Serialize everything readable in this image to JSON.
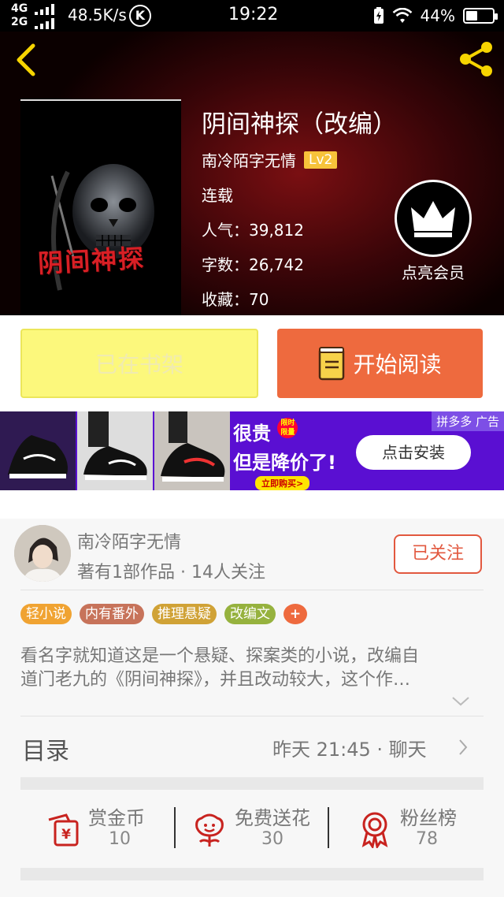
{
  "status_bar": {
    "network_top": "4G",
    "network_bottom": "2G",
    "speed": "48.5K/s",
    "k_icon": "K",
    "time": "19:22",
    "battery": "44%",
    "battery_level": 0.44
  },
  "book": {
    "cover_title": "阴间神探",
    "title": "阴间神探（改编）",
    "author": "南冷陌字无情",
    "level": "Lv2",
    "status": "连载",
    "popularity": "人气：39,812",
    "word_count": "字数：26,742",
    "collections": "收藏：70",
    "vip_label": "点亮会员"
  },
  "actions": {
    "shelf_label": "已在书架",
    "read_label": "开始阅读"
  },
  "ad": {
    "line1": "很贵",
    "tag": "限时限量",
    "line2": "但是降价了!",
    "buy": "立即购买>",
    "install": "点击安装",
    "label": "拼多多 广告"
  },
  "author_card": {
    "name": "南冷陌字无情",
    "sub": "著有1部作品 · 14人关注",
    "follow": "已关注"
  },
  "tags": [
    {
      "label": "轻小说",
      "color": "#f0a332"
    },
    {
      "label": "内有番外",
      "color": "#c7735a"
    },
    {
      "label": "推理悬疑",
      "color": "#d0a236"
    },
    {
      "label": "改编文",
      "color": "#96b23e"
    },
    {
      "label": "+",
      "color": "#ee6a3e"
    }
  ],
  "description": {
    "line1": "看名字就知道这是一个悬疑、探案类的小说，改编自",
    "line2": "道门老九的《阴间神探》，并且改动较大，这个作…"
  },
  "toc": {
    "label": "目录",
    "update": "昨天 21:45 · 聊天"
  },
  "stats": [
    {
      "label": "赏金币",
      "value": "10",
      "icon": "reward-coin-icon"
    },
    {
      "label": "免费送花",
      "value": "30",
      "icon": "flower-icon"
    },
    {
      "label": "粉丝榜",
      "value": "78",
      "icon": "medal-icon"
    }
  ],
  "colors": {
    "accent": "#ee6a3e",
    "shelf_button": "#fcf87c",
    "follow": "#e2583f",
    "icon_red": "#c8231f"
  }
}
